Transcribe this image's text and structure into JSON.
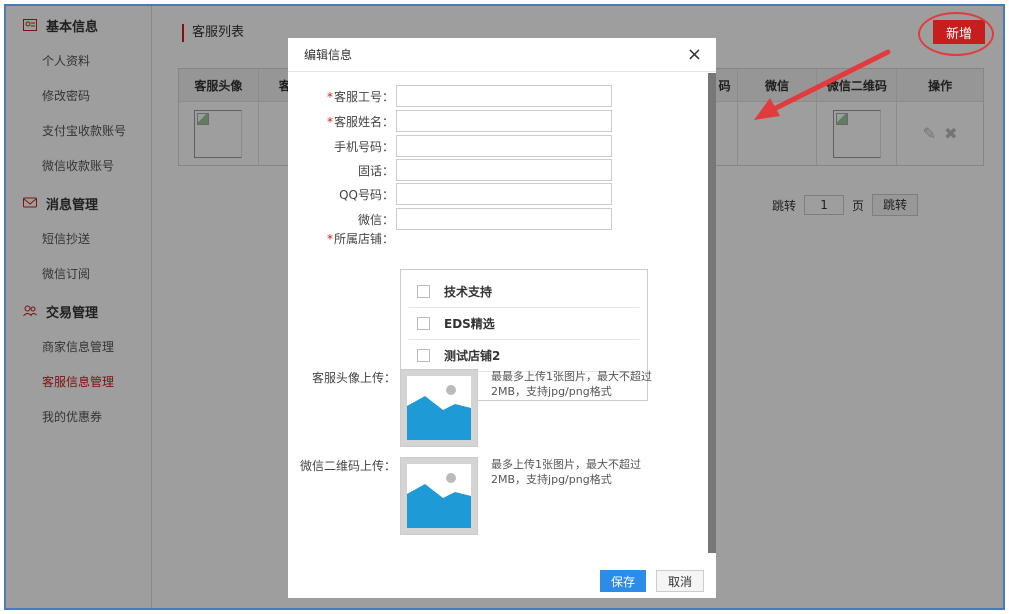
{
  "sidebar": {
    "sections": [
      {
        "title": "基本信息",
        "icon": "user-card-icon",
        "items": [
          "个人资料",
          "修改密码",
          "支付宝收款账号",
          "微信收款账号"
        ]
      },
      {
        "title": "消息管理",
        "icon": "message-icon",
        "items": [
          "短信抄送",
          "微信订阅"
        ]
      },
      {
        "title": "交易管理",
        "icon": "users-icon",
        "items": [
          "商家信息管理",
          "客服信息管理",
          "我的优惠券"
        ]
      }
    ],
    "active_item": "客服信息管理"
  },
  "main": {
    "title": "客服列表",
    "new_button": "新增",
    "table": {
      "headers": [
        "客服头像",
        "客",
        "码",
        "微信",
        "微信二维码",
        "操作"
      ]
    },
    "pager": {
      "jump_label": "跳转",
      "page_value": "1",
      "page_unit": "页",
      "go_button": "跳转"
    }
  },
  "modal": {
    "title": "编辑信息",
    "close": "×",
    "fields": {
      "staff_id": {
        "label": "客服工号：",
        "required": true,
        "value": ""
      },
      "staff_name": {
        "label": "客服姓名：",
        "required": true,
        "value": ""
      },
      "phone": {
        "label": "手机号码：",
        "required": false,
        "value": ""
      },
      "tel": {
        "label": "固话：",
        "required": false,
        "value": ""
      },
      "qq": {
        "label": "QQ号码：",
        "required": false,
        "value": ""
      },
      "wechat": {
        "label": "微信：",
        "required": false,
        "value": ""
      }
    },
    "stores": {
      "label": "所属店铺：",
      "required_mark": "*",
      "options": [
        "技术支持",
        "EDS精选",
        "测试店铺2"
      ]
    },
    "avatar_upload": {
      "label": "客服头像上传：",
      "hint": "最最多上传1张图片，最大不超过2MB，支持jpg/png格式"
    },
    "qrcode_upload": {
      "label": "微信二维码上传：",
      "hint": "最多上传1张图片，最大不超过2MB，支持jpg/png格式"
    },
    "save_button": "保存",
    "cancel_button": "取消"
  },
  "colors": {
    "accent_red": "#c81d1d",
    "primary_blue": "#2d8ce8",
    "frame_blue": "#4a78b8",
    "image_blue": "#1e9ad6"
  }
}
